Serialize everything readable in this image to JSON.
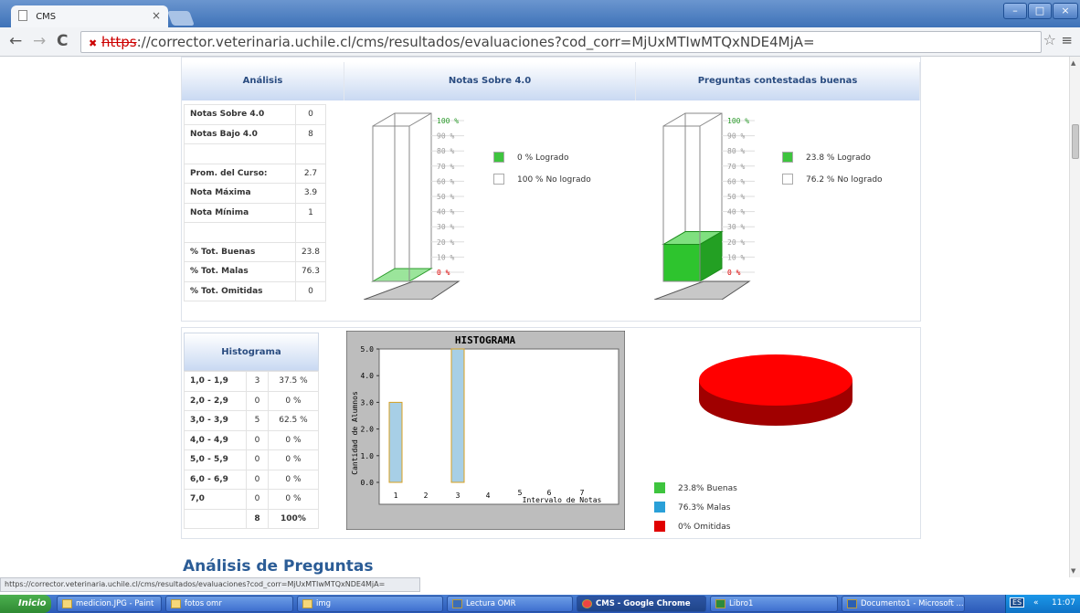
{
  "browser": {
    "tab_title": "CMS",
    "tab_close": "×",
    "url_scheme": "https",
    "url_rest": "://corrector.veterinaria.uchile.cl/cms/resultados/evaluaciones?cod_corr=MjUxMTIwMTQxNDE4MjA=",
    "window_controls": [
      "–",
      "□",
      "×"
    ],
    "back": "←",
    "forward": "→",
    "reload": "C",
    "star": "☆",
    "menu": "≡"
  },
  "analisis": {
    "header": "Análisis",
    "rows": [
      {
        "label": "Notas Sobre 4.0",
        "value": "0"
      },
      {
        "label": "Notas Bajo 4.0",
        "value": "8"
      },
      {
        "label": "",
        "value": ""
      },
      {
        "label": "Prom. del Curso:",
        "value": "2.7"
      },
      {
        "label": "Nota Máxima",
        "value": "3.9"
      },
      {
        "label": "Nota Mínima",
        "value": "1"
      },
      {
        "label": "",
        "value": ""
      },
      {
        "label": "% Tot. Buenas",
        "value": "23.8"
      },
      {
        "label": "% Tot. Malas",
        "value": "76.3"
      },
      {
        "label": "% Tot. Omitidas",
        "value": "0"
      }
    ]
  },
  "notas": {
    "header": "Notas Sobre 4.0",
    "fill_percent": 0,
    "scale": [
      "100 %",
      "90 %",
      "80 %",
      "70 %",
      "60 %",
      "50 %",
      "40 %",
      "30 %",
      "20 %",
      "10 %",
      "0 %"
    ],
    "legend": [
      {
        "label": "0 % Logrado",
        "color": "#3ec43e"
      },
      {
        "label": "100 % No logrado",
        "color": "#ffffff"
      }
    ]
  },
  "preguntas": {
    "header": "Preguntas contestadas buenas",
    "fill_percent": 23.8,
    "scale": [
      "100 %",
      "90 %",
      "80 %",
      "70 %",
      "60 %",
      "50 %",
      "40 %",
      "30 %",
      "20 %",
      "10 %",
      "0 %"
    ],
    "legend": [
      {
        "label": "23.8 % Logrado",
        "color": "#3ec43e"
      },
      {
        "label": "76.2 % No logrado",
        "color": "#ffffff"
      }
    ]
  },
  "histograma_table": {
    "header": "Histograma",
    "rows": [
      {
        "range": "1,0 - 1,9",
        "count": "3",
        "pct": "37.5 %"
      },
      {
        "range": "2,0 - 2,9",
        "count": "0",
        "pct": "0 %"
      },
      {
        "range": "3,0 - 3,9",
        "count": "5",
        "pct": "62.5 %"
      },
      {
        "range": "4,0 - 4,9",
        "count": "0",
        "pct": "0 %"
      },
      {
        "range": "5,0 - 5,9",
        "count": "0",
        "pct": "0 %"
      },
      {
        "range": "6,0 - 6,9",
        "count": "0",
        "pct": "0 %"
      },
      {
        "range": "7,0",
        "count": "0",
        "pct": "0 %"
      }
    ],
    "total": {
      "count": "8",
      "pct": "100%"
    }
  },
  "chart_data": [
    {
      "type": "bar",
      "title": "HISTOGRAMA",
      "xlabel": "Intervalo de Notas",
      "ylabel": "Cantidad de Alumnos",
      "categories": [
        "1",
        "2",
        "3",
        "4",
        "5",
        "6",
        "7"
      ],
      "values": [
        3,
        0,
        5,
        0,
        0,
        0,
        0
      ],
      "ylim": [
        0,
        5
      ],
      "yticks": [
        "0.0",
        "1.0",
        "2.0",
        "3.0",
        "4.0",
        "5.0"
      ],
      "bar_color": "#a7cfe6"
    },
    {
      "type": "pie",
      "labels": [
        "23.8% Buenas",
        "76.3% Malas",
        "0% Omitidas"
      ],
      "values": [
        23.8,
        76.3,
        0
      ],
      "colors": [
        "#3ec43e",
        "#2aa0d8",
        "#e00000"
      ]
    }
  ],
  "section_title": "Análisis de Preguntas",
  "status_url": "https://corrector.veterinaria.uchile.cl/cms/resultados/evaluaciones?cod_corr=MjUxMTIwMTQxNDE4MjA=",
  "taskbar": {
    "start": "Inicio",
    "items": [
      "medicion.JPG - Paint",
      "fotos omr",
      "img",
      "Lectura OMR",
      "CMS - Google Chrome",
      "Libro1",
      "Documento1 - Microsoft ..."
    ],
    "lang": "ES",
    "clock": "11:07",
    "chevron": "«"
  }
}
